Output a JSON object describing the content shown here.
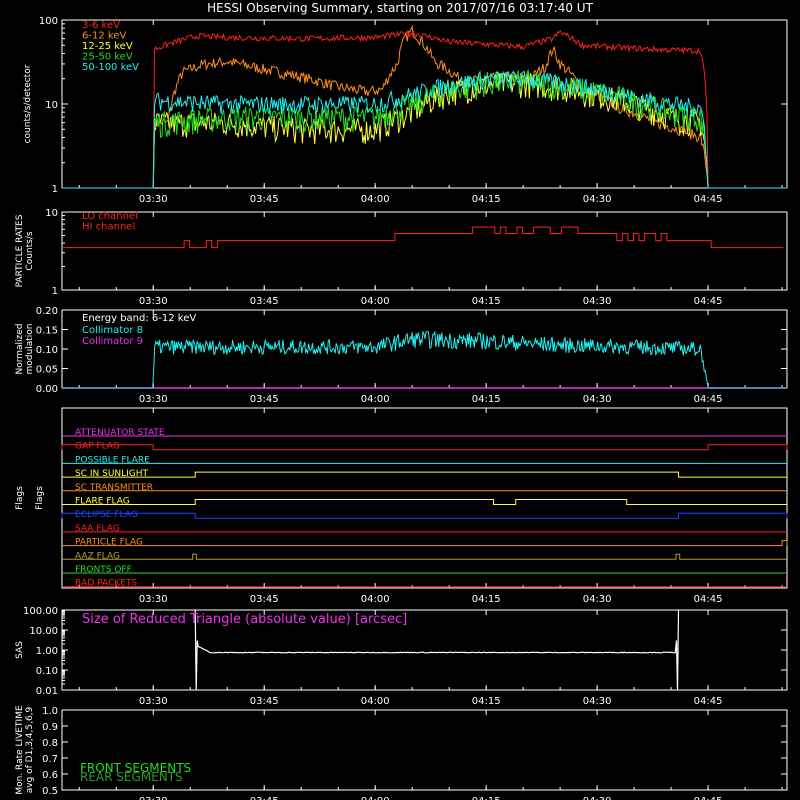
{
  "title": "HESSI Observing Summary, starting on 2017/07/16 03:17:40 UT",
  "colors": {
    "background": "#000000",
    "axes": "#ffffff",
    "red": "#ff2020",
    "orange": "#ff8c1a",
    "yellow": "#ffff33",
    "green": "#22dd22",
    "cyan": "#22eeee",
    "magenta": "#ee33ee",
    "blue": "#2244ff",
    "darkgreen": "#2a9a2a",
    "darkyellow": "#b0a030",
    "white": "#ffffff"
  },
  "time_ticks": [
    "03:30",
    "03:45",
    "04:00",
    "04:15",
    "04:30",
    "04:45"
  ],
  "chart_data": [
    {
      "type": "line",
      "panel": "count-rates",
      "ylabel": "counts/s/detector",
      "yscale": "log",
      "ylim": [
        1,
        100
      ],
      "y_tick_labels": [
        "1",
        "10",
        "100"
      ],
      "x_range": [
        "03:17:40",
        "04:55:40"
      ],
      "series": [
        {
          "name": "3-6 keV",
          "color": "#ff2020",
          "x": [
            "03:17:40",
            "03:30:00",
            "03:30:10",
            "03:33",
            "03:36",
            "03:40",
            "03:50",
            "04:00",
            "04:05",
            "04:10",
            "04:20",
            "04:24",
            "04:25",
            "04:28",
            "04:35",
            "04:40",
            "04:44",
            "04:45",
            "04:55:40"
          ],
          "y": [
            1,
            1,
            45,
            55,
            65,
            62,
            60,
            62,
            70,
            55,
            48,
            60,
            72,
            50,
            46,
            44,
            43,
            1,
            1
          ]
        },
        {
          "name": "6-12 keV",
          "color": "#ff8c1a",
          "x": [
            "03:17:40",
            "03:30:00",
            "03:30:10",
            "03:32",
            "03:34",
            "03:37",
            "03:40",
            "03:45",
            "03:55",
            "03:59",
            "04:01",
            "04:03",
            "04:04",
            "04:05",
            "04:06",
            "04:08",
            "04:12",
            "04:15",
            "04:18",
            "04:21",
            "04:23",
            "04:24",
            "04:25",
            "04:28",
            "04:33",
            "04:38",
            "04:44",
            "04:45",
            "04:55:40"
          ],
          "y": [
            1,
            1,
            6,
            6,
            24,
            30,
            32,
            26,
            16,
            14,
            15,
            30,
            60,
            75,
            60,
            32,
            18,
            20,
            21,
            20,
            28,
            45,
            30,
            15,
            9,
            6,
            4,
            1,
            1
          ]
        },
        {
          "name": "12-25 keV",
          "color": "#ffff33",
          "x": [
            "03:17:40",
            "03:30:00",
            "03:30:10",
            "03:40",
            "03:50",
            "04:00",
            "04:05",
            "04:10",
            "04:15",
            "04:20",
            "04:25",
            "04:30",
            "04:35",
            "04:40",
            "04:44",
            "04:45",
            "04:55:40"
          ],
          "y": [
            1,
            1,
            6,
            6,
            5,
            5,
            8,
            14,
            17,
            18,
            16,
            13,
            10,
            7,
            6,
            1,
            1
          ]
        },
        {
          "name": "25-50 keV",
          "color": "#22dd22",
          "x": [
            "03:17:40",
            "03:30:00",
            "03:30:10",
            "03:40",
            "03:50",
            "04:00",
            "04:05",
            "04:10",
            "04:15",
            "04:20",
            "04:25",
            "04:30",
            "04:35",
            "04:40",
            "04:44",
            "04:45",
            "04:55:40"
          ],
          "y": [
            1,
            1,
            6,
            7,
            7,
            7,
            10,
            15,
            18,
            19,
            17,
            14,
            11,
            8,
            7,
            1,
            1
          ]
        },
        {
          "name": "50-100 keV",
          "color": "#22eeee",
          "x": [
            "03:17:40",
            "03:30:00",
            "03:30:10",
            "03:40",
            "03:50",
            "04:00",
            "04:05",
            "04:10",
            "04:15",
            "04:20",
            "04:25",
            "04:30",
            "04:35",
            "04:40",
            "04:44",
            "04:45",
            "04:55:40"
          ],
          "y": [
            1,
            1,
            11,
            10,
            10,
            10,
            13,
            17,
            20,
            20,
            18,
            15,
            12,
            10,
            9,
            1,
            1
          ]
        }
      ]
    },
    {
      "type": "line",
      "panel": "particle-rates",
      "ylabel": "PARTICLE RATES Counts/s",
      "yscale": "log",
      "ylim": [
        1,
        10
      ],
      "y_tick_labels": [
        "1",
        "10"
      ],
      "x_range": [
        "03:17:40",
        "04:55:40"
      ],
      "series": [
        {
          "name": "LO channel",
          "color": "#ff2020",
          "x": [
            "03:17:40",
            "03:30",
            "03:35",
            "03:40",
            "03:50",
            "04:00",
            "04:10",
            "04:15",
            "04:20",
            "04:25",
            "04:30",
            "04:35",
            "04:40",
            "04:44",
            "04:45",
            "04:55:40"
          ],
          "y": [
            3.5,
            3.5,
            3.8,
            4.3,
            4.3,
            4.5,
            5.3,
            6.0,
            5.8,
            5.5,
            5.2,
            5.0,
            4.5,
            4.2,
            3.5,
            3.5
          ]
        },
        {
          "name": "HI channel",
          "color": "#ff2020",
          "x": [],
          "y": []
        }
      ]
    },
    {
      "type": "line",
      "panel": "modulation",
      "ylabel": "Normalized modulation",
      "ylim": [
        0.0,
        0.2
      ],
      "y_tick_labels": [
        "0.00",
        "0.05",
        "0.10",
        "0.15",
        "0.20"
      ],
      "energy_band": "Energy band: 6-12 keV",
      "x_range": [
        "03:17:40",
        "04:55:40"
      ],
      "series": [
        {
          "name": "Collimator 8",
          "color": "#22eeee",
          "x": [
            "03:17:40",
            "03:30:00",
            "03:30:10",
            "03:45",
            "04:00",
            "04:05",
            "04:15",
            "04:25",
            "04:35",
            "04:44",
            "04:45",
            "04:55:40"
          ],
          "y": [
            0,
            0,
            0.105,
            0.105,
            0.105,
            0.125,
            0.12,
            0.11,
            0.105,
            0.1,
            0,
            0
          ]
        },
        {
          "name": "Collimator 9",
          "color": "#ee33ee",
          "x": [
            "03:17:40",
            "04:55:40"
          ],
          "y": [
            0,
            0
          ]
        }
      ]
    },
    {
      "type": "table",
      "panel": "flags",
      "ylabel": "Flags",
      "x_range": [
        "03:17:40",
        "04:55:40"
      ],
      "rows": [
        {
          "name": "ATTENUATOR STATE",
          "color": "#ee33ee",
          "segments": []
        },
        {
          "name": "GAP FLAG",
          "color": "#ff2020",
          "segments": [
            [
              "03:17:40",
              "03:30"
            ],
            [
              "04:45",
              "04:55:40"
            ]
          ]
        },
        {
          "name": "POSSIBLE FLARE",
          "color": "#22eeee",
          "segments": []
        },
        {
          "name": "SC IN SUNLIGHT",
          "color": "#ffff33",
          "segments": [
            [
              "03:35:40",
              "04:41"
            ]
          ]
        },
        {
          "name": "SC TRANSMITTER",
          "color": "#ff8c1a",
          "segments": []
        },
        {
          "name": "FLARE FLAG",
          "color": "#ffff33",
          "segments": [
            [
              "03:35:40",
              "04:16"
            ],
            [
              "04:19",
              "04:34"
            ]
          ]
        },
        {
          "name": "ECLIPSE FLAG",
          "color": "#2244ff",
          "segments": [
            [
              "03:17:40",
              "03:35:40"
            ],
            [
              "04:41",
              "04:55:40"
            ]
          ]
        },
        {
          "name": "SAA FLAG",
          "color": "#ff2020",
          "segments": []
        },
        {
          "name": "PARTICLE FLAG",
          "color": "#ff8c1a",
          "segments": [
            [
              "04:55",
              "04:55:40"
            ]
          ]
        },
        {
          "name": "AAZ FLAG",
          "color": "#b0a030",
          "segments": [
            [
              "03:35:20",
              "03:35:50"
            ],
            [
              "04:40:40",
              "04:41:10"
            ]
          ]
        },
        {
          "name": "FRONTS OFF",
          "color": "#22dd22",
          "segments": []
        },
        {
          "name": "BAD PACKETS",
          "color": "#ff2020",
          "segments": []
        }
      ]
    },
    {
      "type": "line",
      "panel": "sas",
      "ylabel": "SAS",
      "yscale": "log",
      "ylim": [
        0.01,
        100
      ],
      "y_tick_labels": [
        "0.01",
        "0.10",
        "1.00",
        "10.00",
        "100.00"
      ],
      "series": [
        {
          "name": "Size of Reduced Triangle (absolute value) [arcsec]",
          "color": "#ffffff",
          "x": [
            "03:35:40",
            "03:36",
            "03:40",
            "04:00",
            "04:20",
            "04:40",
            "04:41"
          ],
          "y": [
            100,
            0.9,
            0.75,
            0.72,
            0.72,
            0.78,
            100
          ]
        }
      ]
    },
    {
      "type": "line",
      "panel": "livetime",
      "ylabel": "Mon. Rate LIVETIME avg of D1,3,4,5,6,9",
      "ylim": [
        0.5,
        1.0
      ],
      "y_tick_labels": [
        "0.5",
        "0.6",
        "0.7",
        "0.8",
        "0.9",
        "1.0"
      ],
      "series": [
        {
          "name": "FRONT SEGMENTS",
          "color": "#22dd22",
          "x": [],
          "y": []
        },
        {
          "name": "REAR SEGMENTS",
          "color": "#2a9a2a",
          "x": [],
          "y": []
        }
      ]
    }
  ]
}
